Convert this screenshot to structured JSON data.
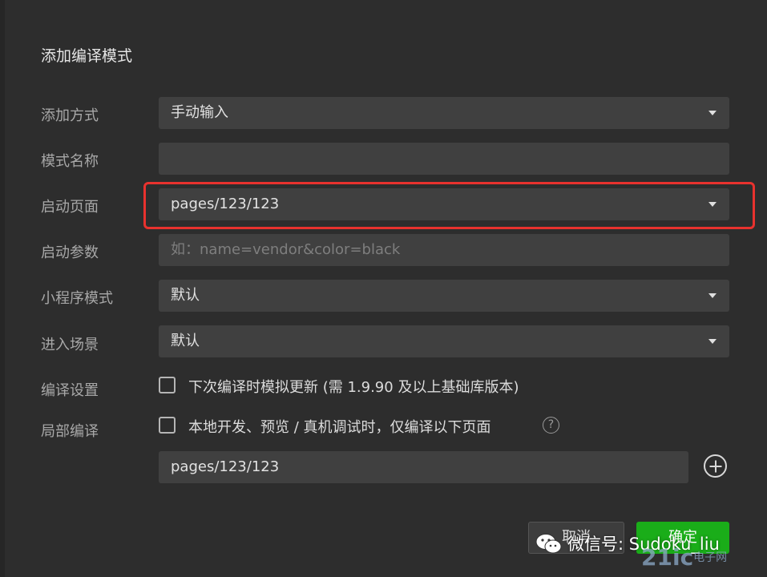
{
  "dialog": {
    "title": "添加编译模式"
  },
  "form": {
    "add_method": {
      "label": "添加方式",
      "value": "手动输入"
    },
    "mode_name": {
      "label": "模式名称",
      "value": ""
    },
    "start_page": {
      "label": "启动页面",
      "value": "pages/123/123"
    },
    "start_params": {
      "label": "启动参数",
      "placeholder": "如：name=vendor&color=black"
    },
    "miniprogram_mode": {
      "label": "小程序模式",
      "value": "默认"
    },
    "scene": {
      "label": "进入场景",
      "value": "默认"
    },
    "compile_settings": {
      "label": "编译设置",
      "checkbox_text": "下次编译时模拟更新 (需 1.9.90 及以上基础库版本)",
      "checked": false
    },
    "partial_compile": {
      "label": "局部编译",
      "checkbox_text": "本地开发、预览 / 真机调试时，仅编译以下页面",
      "checked": false,
      "page_value": "pages/123/123"
    }
  },
  "buttons": {
    "cancel": "取消",
    "confirm": "确定"
  },
  "watermark": {
    "text": "微信号: Sudoku_liu",
    "site": "21ic",
    "site_sub": "电子网"
  },
  "colors": {
    "background": "#2d2d2d",
    "field": "#404040",
    "highlight": "#e8322e",
    "confirm": "#1aad19"
  },
  "icons": {
    "dropdown": "caret-down-icon",
    "help": "question-circle-icon",
    "add": "plus-circle-icon",
    "wechat": "wechat-icon"
  }
}
